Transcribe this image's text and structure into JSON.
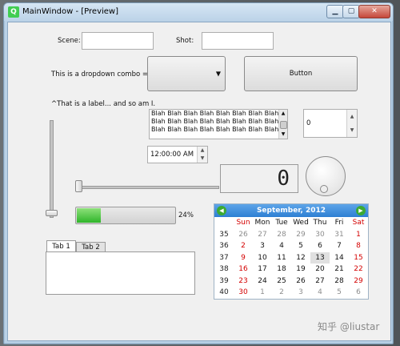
{
  "window": {
    "title": "MainWindow - [Preview]",
    "app_icon_letter": "Q",
    "colors": {
      "calendar_header": "#3a8be0",
      "progress_fill": "#37b92e",
      "red_day": "#d40000"
    }
  },
  "form": {
    "scene_label": "Scene:",
    "scene_value": "",
    "shot_label": "Shot:",
    "shot_value": "",
    "combo_desc": "This is a dropdown combo =>",
    "combo_value": "",
    "button_label": "Button",
    "label_text": "^That is a label... and so am I.",
    "list_rows": [
      "Blah Blah Blah Blah Blah Blah Blah Blah",
      "Blah Blah Blah Blah Blah Blah Blah Blah",
      "Blah Blah Blah Blah Blah Blah Blah Blah"
    ],
    "spin_value": "0",
    "time_value": "12:00:00 AM",
    "lcd_value": "0",
    "horizontal_slider_value": 0,
    "vertical_slider_value": 0,
    "progress_percent": 24,
    "progress_text": "24%",
    "tabs": [
      "Tab 1",
      "Tab 2"
    ],
    "active_tab": "Tab 1"
  },
  "calendar": {
    "month_year": "September, 2012",
    "weekday_headers": [
      "Sun",
      "Mon",
      "Tue",
      "Wed",
      "Thu",
      "Fri",
      "Sat"
    ],
    "weeks": [
      {
        "week": "35",
        "days": [
          "26",
          "27",
          "28",
          "29",
          "30",
          "31",
          "1"
        ]
      },
      {
        "week": "36",
        "days": [
          "2",
          "3",
          "4",
          "5",
          "6",
          "7",
          "8"
        ]
      },
      {
        "week": "37",
        "days": [
          "9",
          "10",
          "11",
          "12",
          "13",
          "14",
          "15"
        ]
      },
      {
        "week": "38",
        "days": [
          "16",
          "17",
          "18",
          "19",
          "20",
          "21",
          "22"
        ]
      },
      {
        "week": "39",
        "days": [
          "23",
          "24",
          "25",
          "26",
          "27",
          "28",
          "29"
        ]
      },
      {
        "week": "40",
        "days": [
          "30",
          "1",
          "2",
          "3",
          "4",
          "5",
          "6"
        ]
      }
    ],
    "selected_day": "13"
  },
  "watermark": "知乎 @liustar"
}
